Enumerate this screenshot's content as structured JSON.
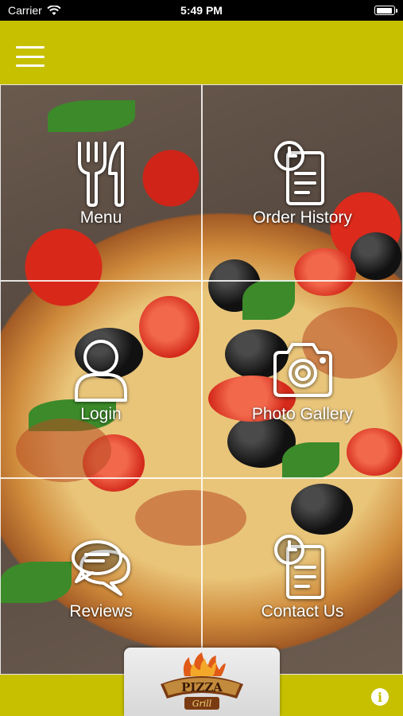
{
  "status_bar": {
    "carrier": "Carrier",
    "time": "5:49 PM"
  },
  "menu_tiles": [
    {
      "label": "Menu",
      "icon": "fork-knife-icon"
    },
    {
      "label": "Order History",
      "icon": "order-history-icon"
    },
    {
      "label": "Login",
      "icon": "user-icon"
    },
    {
      "label": "Photo Gallery",
      "icon": "camera-icon"
    },
    {
      "label": "Reviews",
      "icon": "chat-bubbles-icon"
    },
    {
      "label": "Contact Us",
      "icon": "contact-icon"
    }
  ],
  "logo": {
    "line1": "PIZZA",
    "line2": "Grill"
  },
  "footer": {
    "info_icon": "info-icon"
  },
  "colors": {
    "accent": "#c7c000",
    "icon": "#ffffff"
  }
}
